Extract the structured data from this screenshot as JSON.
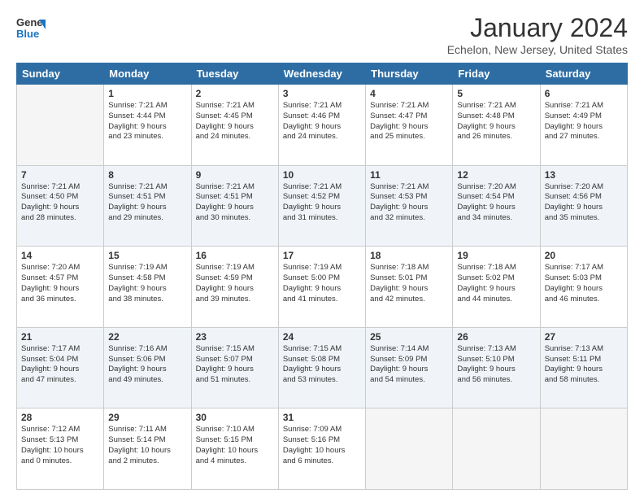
{
  "header": {
    "logo_line1": "General",
    "logo_line2": "Blue",
    "month": "January 2024",
    "location": "Echelon, New Jersey, United States"
  },
  "days_of_week": [
    "Sunday",
    "Monday",
    "Tuesday",
    "Wednesday",
    "Thursday",
    "Friday",
    "Saturday"
  ],
  "weeks": [
    [
      {
        "day": "",
        "info": ""
      },
      {
        "day": "1",
        "info": "Sunrise: 7:21 AM\nSunset: 4:44 PM\nDaylight: 9 hours\nand 23 minutes."
      },
      {
        "day": "2",
        "info": "Sunrise: 7:21 AM\nSunset: 4:45 PM\nDaylight: 9 hours\nand 24 minutes."
      },
      {
        "day": "3",
        "info": "Sunrise: 7:21 AM\nSunset: 4:46 PM\nDaylight: 9 hours\nand 24 minutes."
      },
      {
        "day": "4",
        "info": "Sunrise: 7:21 AM\nSunset: 4:47 PM\nDaylight: 9 hours\nand 25 minutes."
      },
      {
        "day": "5",
        "info": "Sunrise: 7:21 AM\nSunset: 4:48 PM\nDaylight: 9 hours\nand 26 minutes."
      },
      {
        "day": "6",
        "info": "Sunrise: 7:21 AM\nSunset: 4:49 PM\nDaylight: 9 hours\nand 27 minutes."
      }
    ],
    [
      {
        "day": "7",
        "info": "Sunrise: 7:21 AM\nSunset: 4:50 PM\nDaylight: 9 hours\nand 28 minutes."
      },
      {
        "day": "8",
        "info": "Sunrise: 7:21 AM\nSunset: 4:51 PM\nDaylight: 9 hours\nand 29 minutes."
      },
      {
        "day": "9",
        "info": "Sunrise: 7:21 AM\nSunset: 4:51 PM\nDaylight: 9 hours\nand 30 minutes."
      },
      {
        "day": "10",
        "info": "Sunrise: 7:21 AM\nSunset: 4:52 PM\nDaylight: 9 hours\nand 31 minutes."
      },
      {
        "day": "11",
        "info": "Sunrise: 7:21 AM\nSunset: 4:53 PM\nDaylight: 9 hours\nand 32 minutes."
      },
      {
        "day": "12",
        "info": "Sunrise: 7:20 AM\nSunset: 4:54 PM\nDaylight: 9 hours\nand 34 minutes."
      },
      {
        "day": "13",
        "info": "Sunrise: 7:20 AM\nSunset: 4:56 PM\nDaylight: 9 hours\nand 35 minutes."
      }
    ],
    [
      {
        "day": "14",
        "info": "Sunrise: 7:20 AM\nSunset: 4:57 PM\nDaylight: 9 hours\nand 36 minutes."
      },
      {
        "day": "15",
        "info": "Sunrise: 7:19 AM\nSunset: 4:58 PM\nDaylight: 9 hours\nand 38 minutes."
      },
      {
        "day": "16",
        "info": "Sunrise: 7:19 AM\nSunset: 4:59 PM\nDaylight: 9 hours\nand 39 minutes."
      },
      {
        "day": "17",
        "info": "Sunrise: 7:19 AM\nSunset: 5:00 PM\nDaylight: 9 hours\nand 41 minutes."
      },
      {
        "day": "18",
        "info": "Sunrise: 7:18 AM\nSunset: 5:01 PM\nDaylight: 9 hours\nand 42 minutes."
      },
      {
        "day": "19",
        "info": "Sunrise: 7:18 AM\nSunset: 5:02 PM\nDaylight: 9 hours\nand 44 minutes."
      },
      {
        "day": "20",
        "info": "Sunrise: 7:17 AM\nSunset: 5:03 PM\nDaylight: 9 hours\nand 46 minutes."
      }
    ],
    [
      {
        "day": "21",
        "info": "Sunrise: 7:17 AM\nSunset: 5:04 PM\nDaylight: 9 hours\nand 47 minutes."
      },
      {
        "day": "22",
        "info": "Sunrise: 7:16 AM\nSunset: 5:06 PM\nDaylight: 9 hours\nand 49 minutes."
      },
      {
        "day": "23",
        "info": "Sunrise: 7:15 AM\nSunset: 5:07 PM\nDaylight: 9 hours\nand 51 minutes."
      },
      {
        "day": "24",
        "info": "Sunrise: 7:15 AM\nSunset: 5:08 PM\nDaylight: 9 hours\nand 53 minutes."
      },
      {
        "day": "25",
        "info": "Sunrise: 7:14 AM\nSunset: 5:09 PM\nDaylight: 9 hours\nand 54 minutes."
      },
      {
        "day": "26",
        "info": "Sunrise: 7:13 AM\nSunset: 5:10 PM\nDaylight: 9 hours\nand 56 minutes."
      },
      {
        "day": "27",
        "info": "Sunrise: 7:13 AM\nSunset: 5:11 PM\nDaylight: 9 hours\nand 58 minutes."
      }
    ],
    [
      {
        "day": "28",
        "info": "Sunrise: 7:12 AM\nSunset: 5:13 PM\nDaylight: 10 hours\nand 0 minutes."
      },
      {
        "day": "29",
        "info": "Sunrise: 7:11 AM\nSunset: 5:14 PM\nDaylight: 10 hours\nand 2 minutes."
      },
      {
        "day": "30",
        "info": "Sunrise: 7:10 AM\nSunset: 5:15 PM\nDaylight: 10 hours\nand 4 minutes."
      },
      {
        "day": "31",
        "info": "Sunrise: 7:09 AM\nSunset: 5:16 PM\nDaylight: 10 hours\nand 6 minutes."
      },
      {
        "day": "",
        "info": ""
      },
      {
        "day": "",
        "info": ""
      },
      {
        "day": "",
        "info": ""
      }
    ]
  ]
}
